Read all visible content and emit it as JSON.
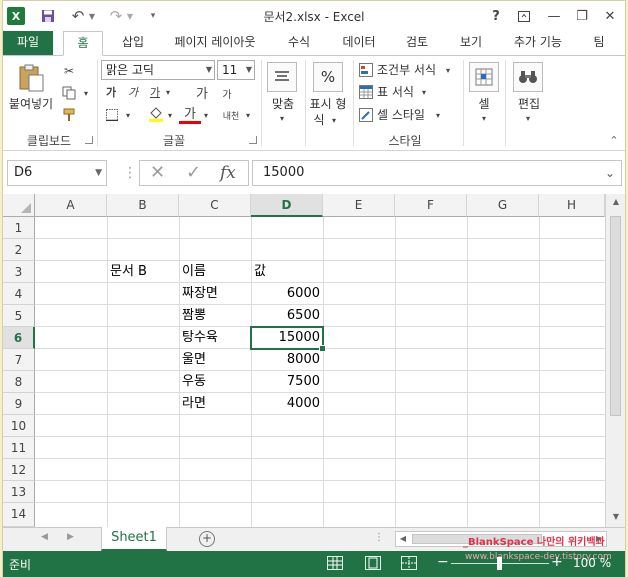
{
  "window": {
    "title": "문서2.xlsx - Excel",
    "controls": [
      "?",
      "⧉",
      "—",
      "❐",
      "✕"
    ]
  },
  "quick_access": {
    "logo": "X"
  },
  "tabs": [
    {
      "label": "파일"
    },
    {
      "label": "홈"
    },
    {
      "label": "삽입"
    },
    {
      "label": "페이지 레이아웃"
    },
    {
      "label": "수식"
    },
    {
      "label": "데이터"
    },
    {
      "label": "검토"
    },
    {
      "label": "보기"
    },
    {
      "label": "추가 기능"
    },
    {
      "label": "팀"
    }
  ],
  "ribbon": {
    "clipboard": {
      "paste_label": "붙여넣기",
      "group": "클립보드"
    },
    "font": {
      "font_name": "맑은 고딕",
      "font_size": "11",
      "bold": "가",
      "italic": "가",
      "underline": "가",
      "grow": "가",
      "shrink": "가",
      "color_a": "가",
      "phonetic": "내천",
      "group": "글꼴"
    },
    "alignment": {
      "label": "맞춤"
    },
    "number": {
      "label_1": "표시 형",
      "label_2": "식",
      "icon": "%"
    },
    "styles": {
      "conditional": "조건부 서식",
      "table": "표 서식",
      "cell_style": "셀 스타일",
      "group": "스타일"
    },
    "cells": {
      "label": "셀"
    },
    "editing": {
      "label": "편집"
    }
  },
  "formula_bar": {
    "name_box": "D6",
    "fx": "fx",
    "value": "15000"
  },
  "grid": {
    "columns": [
      "A",
      "B",
      "C",
      "D",
      "E",
      "F",
      "G",
      "H"
    ],
    "rows": [
      "1",
      "2",
      "3",
      "4",
      "5",
      "6",
      "7",
      "8",
      "9",
      "10",
      "11",
      "12",
      "13",
      "14"
    ],
    "selected_column": "D",
    "selected_row": "6",
    "cells": {
      "B3": "문서 B",
      "C3": "이름",
      "D3": "값",
      "C4": "짜장면",
      "D4": "6000",
      "C5": "짬뽕",
      "D5": "6500",
      "C6": "탕수육",
      "D6": "15000",
      "C7": "울면",
      "D7": "8000",
      "C8": "우동",
      "D8": "7500",
      "C9": "라면",
      "D9": "4000"
    }
  },
  "sheets": {
    "active": "Sheet1",
    "add": "+",
    "watermark": "_BlankSpace 나만의 위키백과"
  },
  "status": {
    "text": "준비",
    "zoom": "100 %",
    "watermark": "www.blankspace-dev.tistory.com"
  }
}
